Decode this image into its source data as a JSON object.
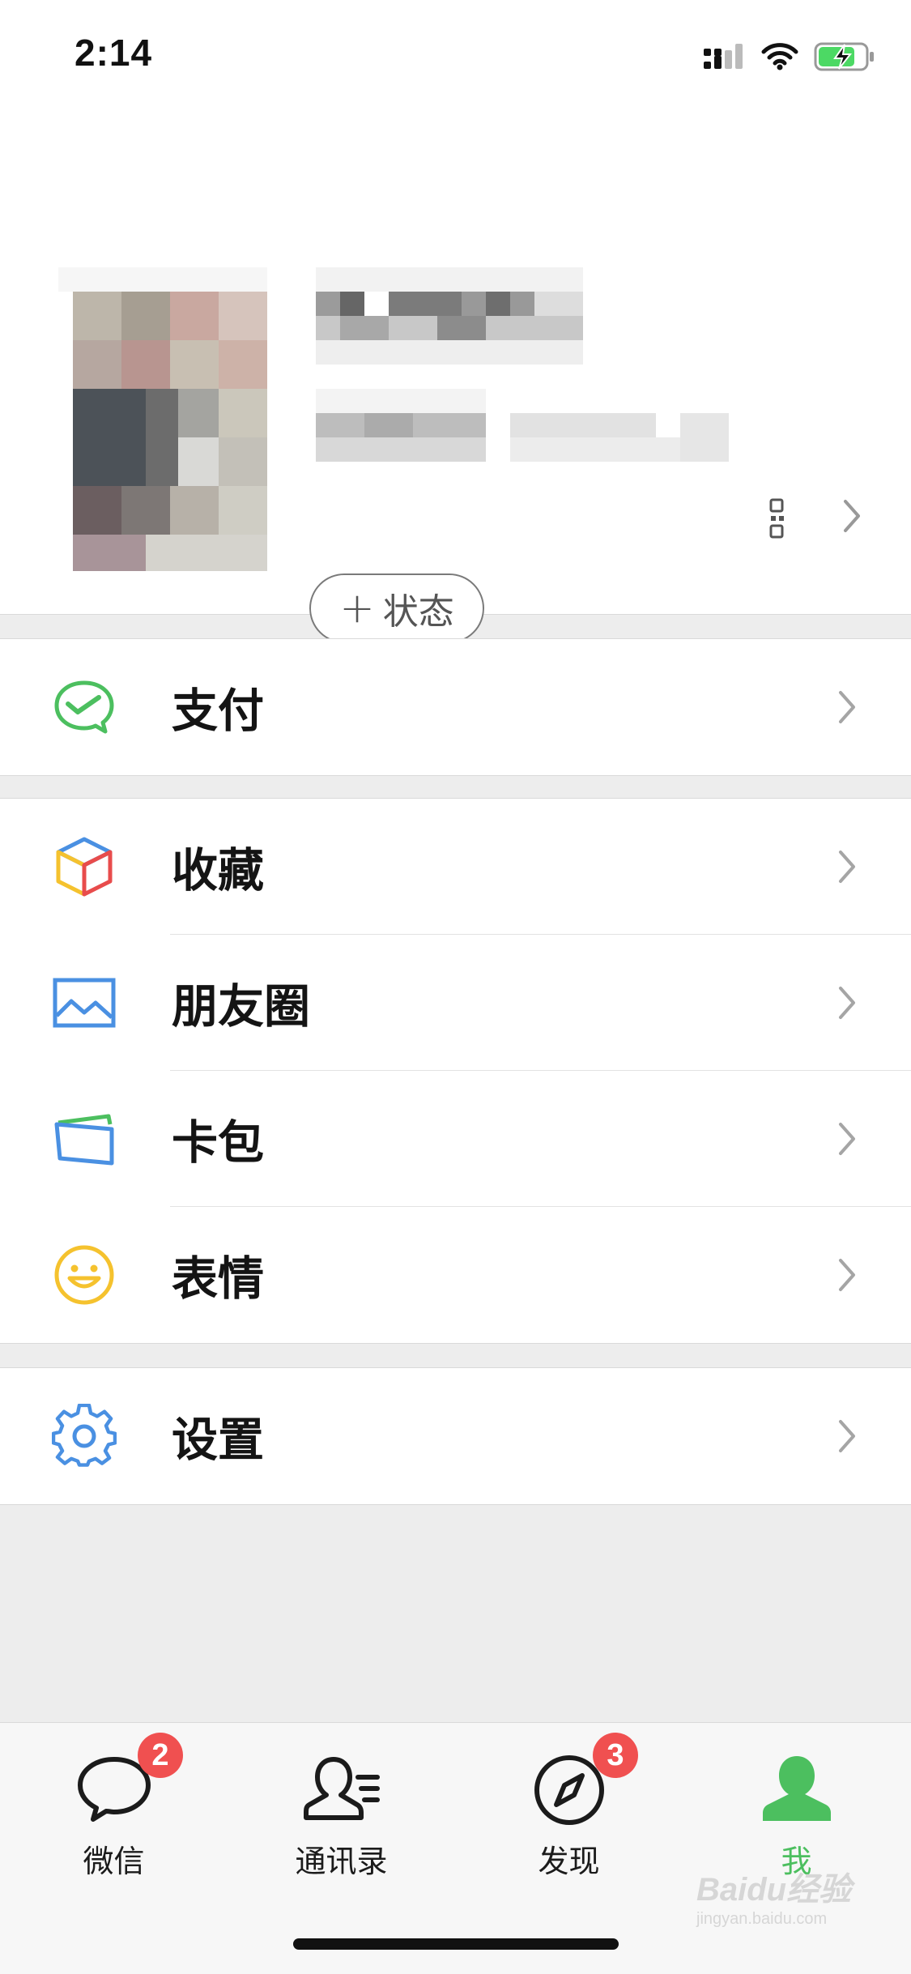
{
  "status_bar": {
    "time": "2:14"
  },
  "profile": {
    "status_button": "状态"
  },
  "groups": [
    {
      "items": [
        {
          "label": "支付",
          "icon": "pay-icon"
        }
      ]
    },
    {
      "items": [
        {
          "label": "收藏",
          "icon": "favorites-cube-icon"
        },
        {
          "label": "朋友圈",
          "icon": "moments-picture-icon"
        },
        {
          "label": "卡包",
          "icon": "card-wallet-icon"
        },
        {
          "label": "表情",
          "icon": "smiley-icon"
        }
      ]
    },
    {
      "items": [
        {
          "label": "设置",
          "icon": "gear-icon"
        }
      ]
    }
  ],
  "tabbar": {
    "tabs": [
      {
        "label": "微信",
        "icon": "chat-bubble-icon",
        "badge": "2",
        "active": false
      },
      {
        "label": "通讯录",
        "icon": "contacts-icon",
        "badge": "",
        "active": false
      },
      {
        "label": "发现",
        "icon": "compass-icon",
        "badge": "3",
        "active": false
      },
      {
        "label": "我",
        "icon": "person-icon",
        "badge": "",
        "active": true
      }
    ]
  },
  "watermark": {
    "brand": "Baidu经验",
    "url": "jingyan.baidu.com"
  },
  "colors": {
    "accent": "#4cbf5f",
    "badge": "#f05050",
    "background": "#ededed"
  }
}
